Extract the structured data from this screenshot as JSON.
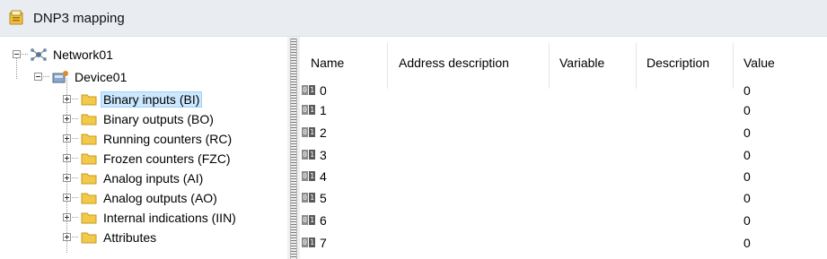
{
  "window": {
    "title": "DNP3 mapping",
    "title_icon": "dnp3-mapping-icon"
  },
  "tree": {
    "network": {
      "label": "Network01",
      "icon": "network-icon",
      "expanded": true
    },
    "device": {
      "label": "Device01",
      "icon": "device-icon",
      "expanded": true
    },
    "groups": [
      {
        "label": "Binary inputs (BI)",
        "icon": "folder-icon",
        "selected": true
      },
      {
        "label": "Binary outputs (BO)",
        "icon": "folder-icon",
        "selected": false
      },
      {
        "label": "Running counters (RC)",
        "icon": "folder-icon",
        "selected": false
      },
      {
        "label": "Frozen counters (FZC)",
        "icon": "folder-icon",
        "selected": false
      },
      {
        "label": "Analog inputs (AI)",
        "icon": "folder-icon",
        "selected": false
      },
      {
        "label": "Analog outputs (AO)",
        "icon": "folder-icon",
        "selected": false
      },
      {
        "label": "Internal indications (IIN)",
        "icon": "folder-icon",
        "selected": false
      },
      {
        "label": "Attributes",
        "icon": "folder-icon",
        "selected": false
      }
    ]
  },
  "list": {
    "columns": [
      "Name",
      "Address description",
      "Variable",
      "Description",
      "Value"
    ],
    "rows": [
      {
        "name": "0",
        "address_description": "",
        "variable": "",
        "description": "",
        "value": "0"
      },
      {
        "name": "1",
        "address_description": "",
        "variable": "",
        "description": "",
        "value": "0"
      },
      {
        "name": "2",
        "address_description": "",
        "variable": "",
        "description": "",
        "value": "0"
      },
      {
        "name": "3",
        "address_description": "",
        "variable": "",
        "description": "",
        "value": "0"
      },
      {
        "name": "4",
        "address_description": "",
        "variable": "",
        "description": "",
        "value": "0"
      },
      {
        "name": "5",
        "address_description": "",
        "variable": "",
        "description": "",
        "value": "0"
      },
      {
        "name": "6",
        "address_description": "",
        "variable": "",
        "description": "",
        "value": "0"
      },
      {
        "name": "7",
        "address_description": "",
        "variable": "",
        "description": "",
        "value": "0"
      }
    ],
    "row_icon": "binary-point-icon"
  },
  "colors": {
    "titlebar_bg": "#e9edf2",
    "selection_bg": "#cce8ff",
    "selection_border": "#99d1ff",
    "folder": "#f3c94a"
  }
}
